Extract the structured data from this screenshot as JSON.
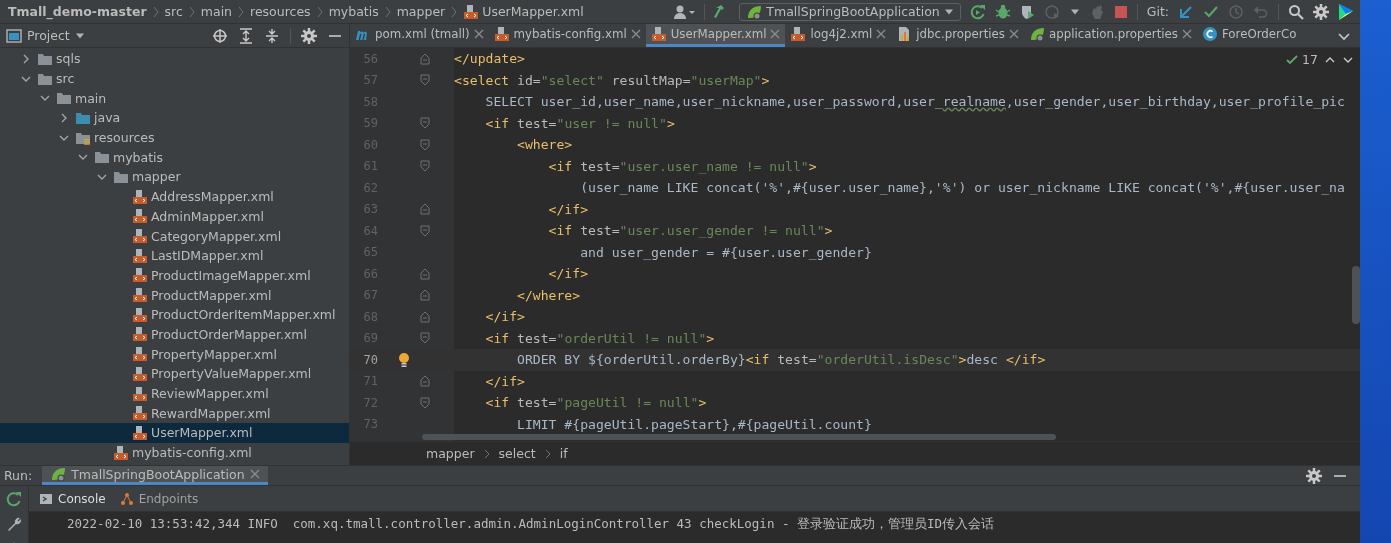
{
  "breadcrumbs": [
    {
      "label": "Tmall_demo-master",
      "kind": "project"
    },
    {
      "label": "src",
      "kind": "dir"
    },
    {
      "label": "main",
      "kind": "dir"
    },
    {
      "label": "resources",
      "kind": "dir"
    },
    {
      "label": "mybatis",
      "kind": "dir"
    },
    {
      "label": "mapper",
      "kind": "dir"
    },
    {
      "label": "UserMapper.xml",
      "kind": "xml"
    }
  ],
  "run_config": {
    "label": "TmallSpringBootApplication"
  },
  "git_label": "Git:",
  "project_panel": {
    "title": "Project"
  },
  "tree": [
    {
      "label": "sqls",
      "kind": "folder",
      "expanded": false,
      "selected": false
    },
    {
      "label": "src",
      "kind": "folder",
      "expanded": true,
      "selected": false,
      "children": [
        {
          "label": "main",
          "kind": "folder",
          "expanded": true,
          "selected": false,
          "children": [
            {
              "label": "java",
              "kind": "source",
              "expanded": false,
              "selected": false
            },
            {
              "label": "resources",
              "kind": "resources",
              "expanded": true,
              "selected": false,
              "children": [
                {
                  "label": "mybatis",
                  "kind": "folder",
                  "expanded": true,
                  "selected": false,
                  "children": [
                    {
                      "label": "mapper",
                      "kind": "folder",
                      "expanded": true,
                      "selected": false,
                      "children": [
                        {
                          "label": "AddressMapper.xml",
                          "kind": "xml",
                          "selected": false
                        },
                        {
                          "label": "AdminMapper.xml",
                          "kind": "xml",
                          "selected": false
                        },
                        {
                          "label": "CategoryMapper.xml",
                          "kind": "xml",
                          "selected": false
                        },
                        {
                          "label": "LastIDMapper.xml",
                          "kind": "xml",
                          "selected": false
                        },
                        {
                          "label": "ProductImageMapper.xml",
                          "kind": "xml",
                          "selected": false
                        },
                        {
                          "label": "ProductMapper.xml",
                          "kind": "xml",
                          "selected": false
                        },
                        {
                          "label": "ProductOrderItemMapper.xml",
                          "kind": "xml",
                          "selected": false
                        },
                        {
                          "label": "ProductOrderMapper.xml",
                          "kind": "xml",
                          "selected": false
                        },
                        {
                          "label": "PropertyMapper.xml",
                          "kind": "xml",
                          "selected": false
                        },
                        {
                          "label": "PropertyValueMapper.xml",
                          "kind": "xml",
                          "selected": false
                        },
                        {
                          "label": "ReviewMapper.xml",
                          "kind": "xml",
                          "selected": false
                        },
                        {
                          "label": "RewardMapper.xml",
                          "kind": "xml",
                          "selected": false
                        },
                        {
                          "label": "UserMapper.xml",
                          "kind": "xml",
                          "selected": true
                        }
                      ]
                    },
                    {
                      "label": "mybatis-config.xml",
                      "kind": "xml",
                      "selected": false
                    }
                  ]
                }
              ]
            }
          ]
        }
      ]
    }
  ],
  "tabs": [
    {
      "label": "pom.xml (tmall)",
      "kind": "maven",
      "selected": false,
      "closable": true
    },
    {
      "label": "mybatis-config.xml",
      "kind": "xml",
      "selected": false,
      "closable": true
    },
    {
      "label": "UserMapper.xml",
      "kind": "xml",
      "selected": true,
      "closable": true
    },
    {
      "label": "log4j2.xml",
      "kind": "xml",
      "selected": false,
      "closable": true
    },
    {
      "label": "jdbc.properties",
      "kind": "properties",
      "selected": false,
      "closable": true
    },
    {
      "label": "application.properties",
      "kind": "spring",
      "selected": false,
      "closable": true
    },
    {
      "label": "ForeOrderCo",
      "kind": "class",
      "selected": false,
      "closable": false
    }
  ],
  "inspection": {
    "count": "17"
  },
  "code": [
    {
      "number": "56",
      "current": false,
      "bulb": false,
      "fold_start": false,
      "fold_end": true,
      "tokens": [
        {
          "kind": "tag",
          "text": "</update>"
        }
      ]
    },
    {
      "number": "57",
      "current": false,
      "bulb": false,
      "fold_start": true,
      "fold_end": false,
      "tokens": [
        {
          "kind": "tag",
          "text": "<select"
        },
        {
          "kind": "attr",
          "text": " id="
        },
        {
          "kind": "str",
          "text": "\"select\""
        },
        {
          "kind": "attr",
          "text": " resultMap="
        },
        {
          "kind": "str",
          "text": "\"userMap\""
        },
        {
          "kind": "tag",
          "text": ">"
        }
      ]
    },
    {
      "number": "58",
      "current": false,
      "bulb": false,
      "fold_start": false,
      "fold_end": false,
      "tokens": [
        {
          "kind": "text",
          "text": "    SELECT user_id,user_name,user_nickname,user_password,user_"
        },
        {
          "kind": "typo",
          "text": "realname"
        },
        {
          "kind": "text",
          "text": ",user_gender,user_birthday,user_profile_pic"
        }
      ]
    },
    {
      "number": "59",
      "current": false,
      "bulb": false,
      "fold_start": true,
      "fold_end": false,
      "tokens": [
        {
          "kind": "tag",
          "text": "    <if"
        },
        {
          "kind": "attr",
          "text": " test="
        },
        {
          "kind": "str",
          "text": "\"user != null\""
        },
        {
          "kind": "tag",
          "text": ">"
        }
      ]
    },
    {
      "number": "60",
      "current": false,
      "bulb": false,
      "fold_start": true,
      "fold_end": false,
      "tokens": [
        {
          "kind": "tag",
          "text": "        <where>"
        }
      ]
    },
    {
      "number": "61",
      "current": false,
      "bulb": false,
      "fold_start": true,
      "fold_end": false,
      "tokens": [
        {
          "kind": "tag",
          "text": "            <if"
        },
        {
          "kind": "attr",
          "text": " test="
        },
        {
          "kind": "str",
          "text": "\"user.user_name != null\""
        },
        {
          "kind": "tag",
          "text": ">"
        }
      ]
    },
    {
      "number": "62",
      "current": false,
      "bulb": false,
      "fold_start": false,
      "fold_end": false,
      "tokens": [
        {
          "kind": "text",
          "text": "                (user_name LIKE concat('%',#{user.user_name},'%') or user_nickname LIKE concat('%',#{user.user_na"
        }
      ]
    },
    {
      "number": "63",
      "current": false,
      "bulb": false,
      "fold_start": false,
      "fold_end": true,
      "tokens": [
        {
          "kind": "tag",
          "text": "            </if>"
        }
      ]
    },
    {
      "number": "64",
      "current": false,
      "bulb": false,
      "fold_start": true,
      "fold_end": false,
      "tokens": [
        {
          "kind": "tag",
          "text": "            <if"
        },
        {
          "kind": "attr",
          "text": " test="
        },
        {
          "kind": "str",
          "text": "\"user.user_gender != null\""
        },
        {
          "kind": "tag",
          "text": ">"
        }
      ]
    },
    {
      "number": "65",
      "current": false,
      "bulb": false,
      "fold_start": false,
      "fold_end": false,
      "tokens": [
        {
          "kind": "text",
          "text": "                and user_gender = #{user.user_gender}"
        }
      ]
    },
    {
      "number": "66",
      "current": false,
      "bulb": false,
      "fold_start": false,
      "fold_end": true,
      "tokens": [
        {
          "kind": "tag",
          "text": "            </if>"
        }
      ]
    },
    {
      "number": "67",
      "current": false,
      "bulb": false,
      "fold_start": false,
      "fold_end": true,
      "tokens": [
        {
          "kind": "tag",
          "text": "        </where>"
        }
      ]
    },
    {
      "number": "68",
      "current": false,
      "bulb": false,
      "fold_start": false,
      "fold_end": true,
      "tokens": [
        {
          "kind": "tag",
          "text": "    </if>"
        }
      ]
    },
    {
      "number": "69",
      "current": false,
      "bulb": false,
      "fold_start": true,
      "fold_end": false,
      "tokens": [
        {
          "kind": "tag",
          "text": "    <if"
        },
        {
          "kind": "attr",
          "text": " test="
        },
        {
          "kind": "str",
          "text": "\"orderUtil != null\""
        },
        {
          "kind": "tag",
          "text": ">"
        }
      ]
    },
    {
      "number": "70",
      "current": true,
      "bulb": true,
      "fold_start": false,
      "fold_end": false,
      "tokens": [
        {
          "kind": "text",
          "text": "        ORDER BY ${orderUtil.orderBy}"
        },
        {
          "kind": "tag",
          "text": "<if"
        },
        {
          "kind": "attr",
          "text": " test="
        },
        {
          "kind": "str",
          "text": "\"orderUtil.isDesc\""
        },
        {
          "kind": "tag",
          "text": ">"
        },
        {
          "kind": "text",
          "text": "desc "
        },
        {
          "kind": "tag",
          "text": "</if>"
        }
      ]
    },
    {
      "number": "71",
      "current": false,
      "bulb": false,
      "fold_start": false,
      "fold_end": true,
      "tokens": [
        {
          "kind": "tag",
          "text": "    </if>"
        }
      ]
    },
    {
      "number": "72",
      "current": false,
      "bulb": false,
      "fold_start": true,
      "fold_end": false,
      "tokens": [
        {
          "kind": "tag",
          "text": "    <if"
        },
        {
          "kind": "attr",
          "text": " test="
        },
        {
          "kind": "str",
          "text": "\"pageUtil != null\""
        },
        {
          "kind": "tag",
          "text": ">"
        }
      ]
    },
    {
      "number": "73",
      "current": false,
      "bulb": false,
      "fold_start": false,
      "fold_end": false,
      "tokens": [
        {
          "kind": "text",
          "text": "        LIMIT #{pageUtil.pageStart},#{pageUtil.count}"
        }
      ]
    }
  ],
  "editor_breadcrumbs": [
    "mapper",
    "select",
    "if"
  ],
  "run_panel": {
    "label": "Run:",
    "tab": "TmallSpringBootApplication",
    "subtabs": [
      {
        "label": "Console",
        "kind": "console",
        "selected": true
      },
      {
        "label": "Endpoints",
        "kind": "endpoints",
        "selected": false
      }
    ],
    "log": "2022-02-10 13:53:42,344 INFO  com.xq.tmall.controller.admin.AdminLoginController 43 checkLogin - 登录验证成功，管理员ID传入会话"
  }
}
